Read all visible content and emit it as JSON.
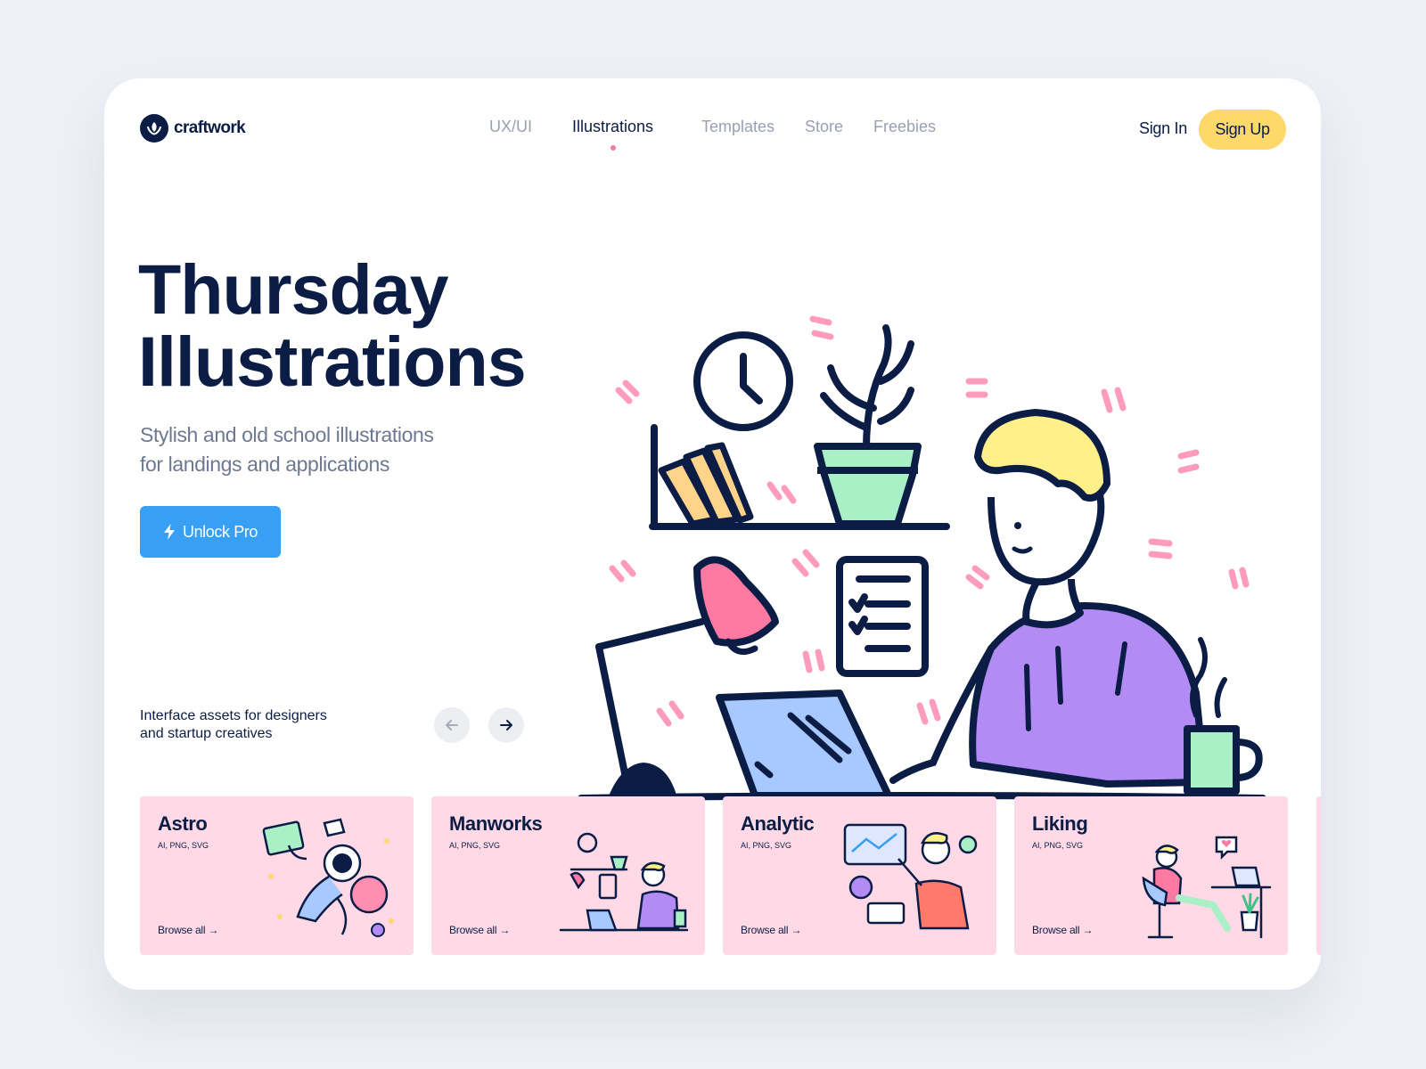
{
  "brand": {
    "name": "craftwork"
  },
  "nav": {
    "items": [
      {
        "label": "UX/UI"
      },
      {
        "label": "Illustrations"
      },
      {
        "label": "Templates"
      },
      {
        "label": "Store"
      },
      {
        "label": "Freebies"
      }
    ],
    "active_index": 1
  },
  "auth": {
    "signin_label": "Sign In",
    "signup_label": "Sign Up"
  },
  "hero": {
    "title_line1": "Thursday",
    "title_line2": "Illustrations",
    "subtitle_line1": "Stylish and old school illustrations",
    "subtitle_line2": "for landings and applications",
    "cta_label": "Unlock Pro",
    "tagline_line1": "Interface assets for designers",
    "tagline_line2": "and startup creatives"
  },
  "carousel": {
    "cards": [
      {
        "title": "Astro",
        "formats": "AI, PNG, SVG",
        "browse_label": "Browse all →"
      },
      {
        "title": "Manworks",
        "formats": "AI, PNG, SVG",
        "browse_label": "Browse all →"
      },
      {
        "title": "Analytic",
        "formats": "AI, PNG, SVG",
        "browse_label": "Browse all →"
      },
      {
        "title": "Liking",
        "formats": "AI, PNG, SVG",
        "browse_label": "Browse all →"
      }
    ]
  },
  "colors": {
    "page_bg": "#edf0f5",
    "navy": "#0c1d45",
    "accent_yellow": "#ffd86b",
    "accent_blue": "#37a0f4",
    "card_pink": "#ffd9e6",
    "accent_pink": "#ff7aa2",
    "accent_purple": "#b38bf5",
    "accent_green": "#a9f0c6"
  },
  "icons": {
    "logo": "leaf-logo-icon",
    "cta": "lightning-icon",
    "prev": "arrow-left-icon",
    "next": "arrow-right-icon"
  }
}
